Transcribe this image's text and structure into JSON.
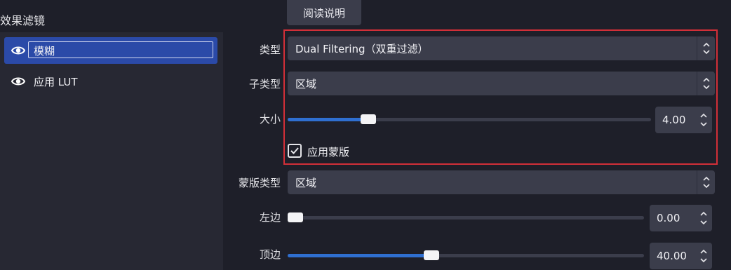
{
  "sidebar": {
    "title": "效果滤镜",
    "filters": [
      {
        "label": "模糊",
        "visible": true,
        "selected": true,
        "icon": "eye-icon"
      },
      {
        "label": "应用 LUT",
        "visible": true,
        "selected": false,
        "icon": "eye-icon"
      }
    ]
  },
  "properties": {
    "readme_button": "阅读说明",
    "type": {
      "label": "类型",
      "value": "Dual Filtering（双重过滤）"
    },
    "subtype": {
      "label": "子类型",
      "value": "区域"
    },
    "size": {
      "label": "大小",
      "value": "4.00",
      "fraction": 0.21
    },
    "apply_mask": {
      "label": "应用蒙版",
      "checked": true
    },
    "mask_type": {
      "label": "蒙版类型",
      "value": "区域"
    },
    "left": {
      "label": "左边",
      "value": "0.00",
      "fraction": 0.0
    },
    "top": {
      "label": "顶边",
      "value": "40.00",
      "fraction": 0.4
    }
  },
  "colors": {
    "accent": "#2f6fd0",
    "selected_bg": "#2b4aa8",
    "highlight_border": "#d22f38",
    "panel_bg": "#1e1f29",
    "control_bg": "#3b3d4b"
  }
}
